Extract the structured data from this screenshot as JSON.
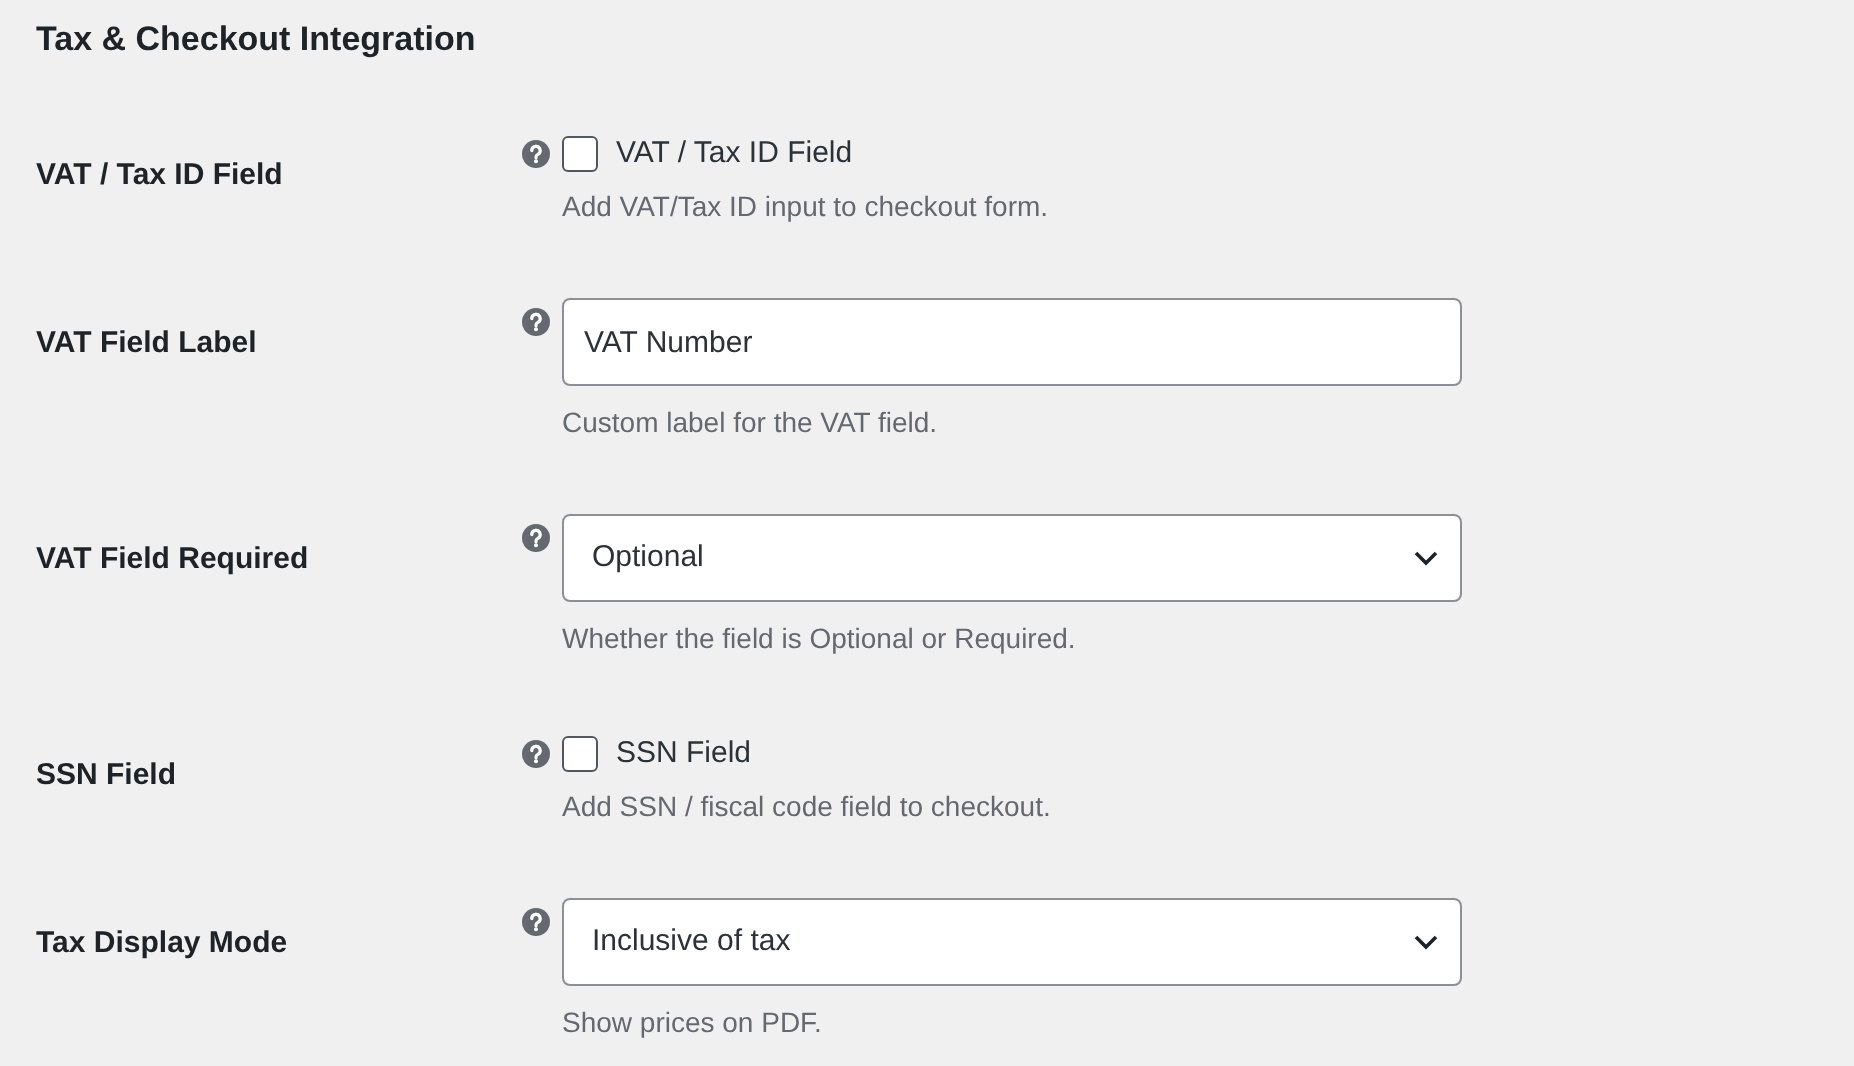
{
  "title": "Tax & Checkout Integration",
  "fields": [
    {
      "kind": "checkbox",
      "label": "VAT / Tax ID Field",
      "checkbox_label": "VAT / Tax ID Field",
      "checked": false,
      "description": "Add VAT/Tax ID input to checkout form."
    },
    {
      "kind": "text",
      "label": "VAT Field Label",
      "value": "VAT Number",
      "description": "Custom label for the VAT field."
    },
    {
      "kind": "select",
      "label": "VAT Field Required",
      "value": "Optional",
      "description": "Whether the field is Optional or Required."
    },
    {
      "kind": "checkbox",
      "label": "SSN Field",
      "checkbox_label": "SSN Field",
      "checked": false,
      "description": "Add SSN / fiscal code field to checkout."
    },
    {
      "kind": "select",
      "label": "Tax Display Mode",
      "value": "Inclusive of tax",
      "description": "Show prices on PDF."
    }
  ]
}
